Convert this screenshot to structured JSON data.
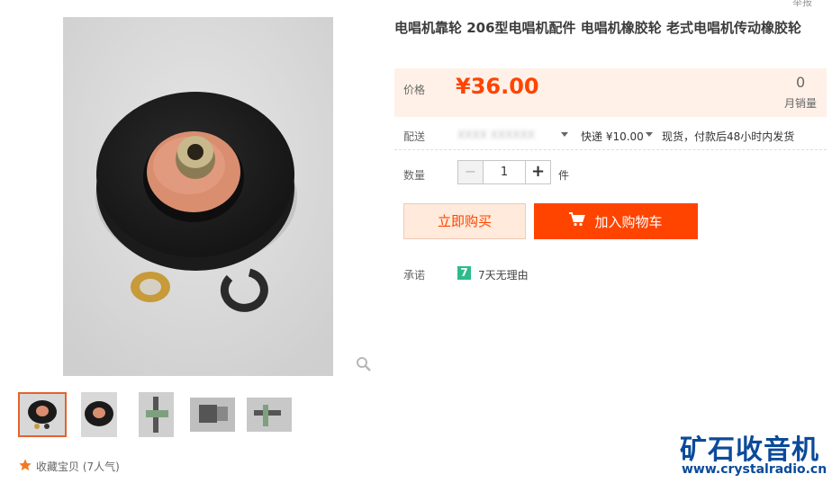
{
  "product": {
    "title": "电唱机靠轮 206型电唱机配件 电唱机橡胶轮 老式电唱机传动橡胶轮",
    "top_cut_text": "举报"
  },
  "price": {
    "label": "价格",
    "value": "¥36.00"
  },
  "sales": {
    "count": "0",
    "label": "月销量"
  },
  "shipping": {
    "label": "配送",
    "from": "XXXX XXXXXX",
    "method": "快递 ¥10.00",
    "stock_note": "现货，付款后48小时内发货"
  },
  "quantity": {
    "label": "数量",
    "value": "1",
    "unit": "件",
    "minus": "−",
    "plus": "+"
  },
  "actions": {
    "buy_now": "立即购买",
    "add_to_cart": "加入购物车"
  },
  "promise": {
    "label": "承诺",
    "badge": "7",
    "text": "7天无理由"
  },
  "favorite": {
    "label": "收藏宝贝 (7人气)"
  },
  "watermark": {
    "name": "矿石收音机",
    "url": "www.crystalradio.cn"
  },
  "colors": {
    "accent": "#ff4400",
    "price_bg": "#fff1e8",
    "promise_green": "#2dbb8e",
    "watermark_blue": "#0b4a9a"
  },
  "icons": [
    "zoom-icon",
    "cart-icon",
    "star-icon",
    "chevron-down-icon"
  ]
}
